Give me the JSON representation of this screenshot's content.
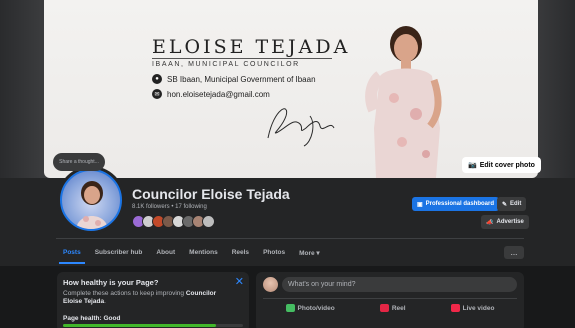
{
  "cover": {
    "name": "ELOISE TEJADA",
    "title": "IBAAN, MUNICIPAL COUNCILOR",
    "location": "SB Ibaan, Municipal Government of Ibaan",
    "email": "hon.eloisetejada@gmail.com",
    "signature": "Eloise Tejada",
    "location_icon": "map-pin-icon",
    "email_icon": "envelope-icon"
  },
  "buttons": {
    "edit_cover": "Edit cover photo",
    "professional_dashboard": "Professional dashboard",
    "edit": "Edit",
    "advertise": "Advertise",
    "more": "..."
  },
  "thought_prompt": "Share a thought...",
  "profile": {
    "name": "Councilor Eloise Tejada",
    "followers": "8.1K followers • 17 following"
  },
  "tabs": [
    {
      "label": "Posts",
      "active": true
    },
    {
      "label": "Subscriber hub"
    },
    {
      "label": "About"
    },
    {
      "label": "Mentions"
    },
    {
      "label": "Reels"
    },
    {
      "label": "Photos"
    },
    {
      "label": "More ▾"
    }
  ],
  "health_card": {
    "title": "How healthy is your Page?",
    "desc_prefix": "Complete these actions to keep improving ",
    "desc_name": "Councilor Eloise Tejada",
    "desc_suffix": ".",
    "health_label": "Page health: Good",
    "health_fraction": 0.85,
    "close_icon": "close-icon"
  },
  "composer": {
    "placeholder": "What's on your mind?",
    "actions": [
      {
        "label": "Photo/video",
        "color": "#45bd62"
      },
      {
        "label": "Reel",
        "color": "#e42645"
      },
      {
        "label": "Live video",
        "color": "#f02849"
      }
    ]
  },
  "colors": {
    "accent": "#1b74e4",
    "tab_active": "#2d88ff",
    "progress": "#42b72a",
    "surface": "#242526",
    "background": "#18191a"
  }
}
